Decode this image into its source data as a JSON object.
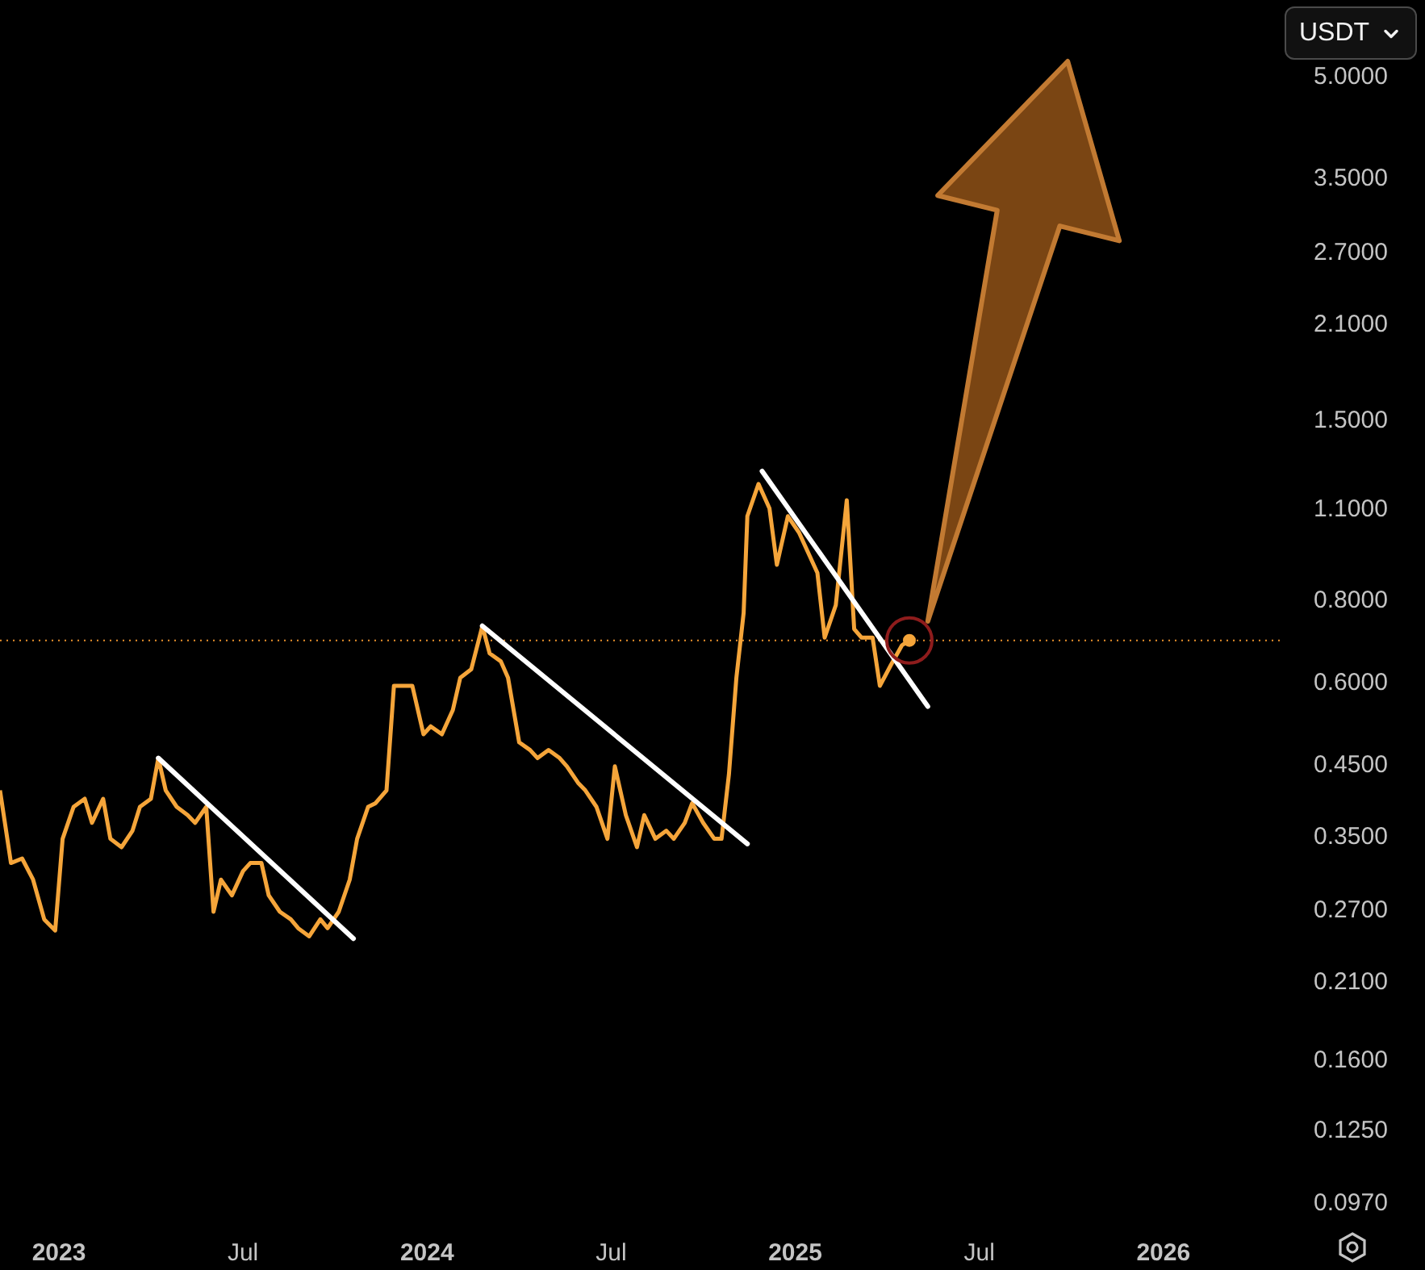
{
  "currency_select": {
    "value": "USDT"
  },
  "price_axis": {
    "labels": [
      "5.0000",
      "3.5000",
      "2.7000",
      "2.1000",
      "1.5000",
      "1.1000",
      "0.8000",
      "0.6000",
      "0.4500",
      "0.3500",
      "0.2700",
      "0.2100",
      "0.1600",
      "0.1250",
      "0.0970"
    ]
  },
  "time_axis": {
    "labels": [
      {
        "text": "2023",
        "kind": "year"
      },
      {
        "text": "Jul",
        "kind": "month"
      },
      {
        "text": "2024",
        "kind": "year"
      },
      {
        "text": "Jul",
        "kind": "month"
      },
      {
        "text": "2025",
        "kind": "year"
      },
      {
        "text": "Jul",
        "kind": "month"
      },
      {
        "text": "2026",
        "kind": "year"
      }
    ]
  }
}
